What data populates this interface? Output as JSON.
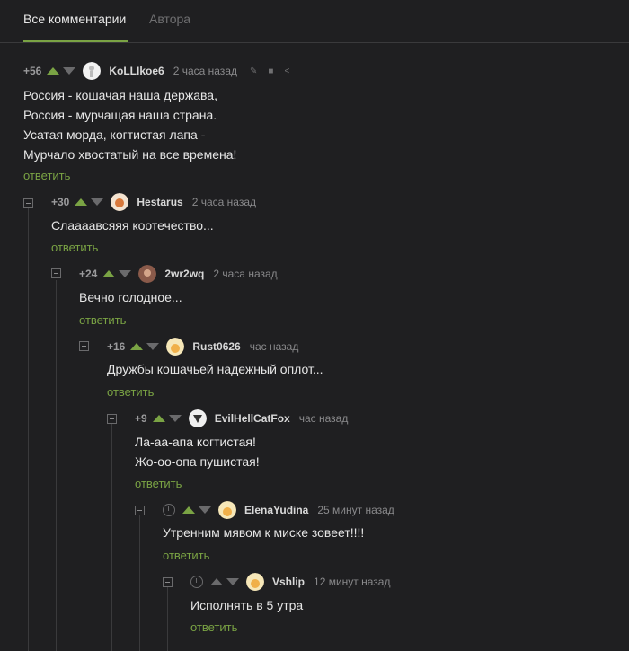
{
  "tabs": {
    "all_comments": "Все комментарии",
    "author": "Автора"
  },
  "colors": {
    "accent": "#7aa344",
    "background": "#1f1f21"
  },
  "comments": [
    {
      "score": "+56",
      "username": "KoLLIkoe6",
      "time": "2 часа назад",
      "lines": [
        "Россия - кошачая наша держава,",
        "Россия - мурчащая наша страна.",
        "Усатая морда, когтистая лапа -",
        "Мурчало хвостатый на все времена!"
      ],
      "reply": "ответить",
      "icons": [
        "pencil-icon",
        "save-icon",
        "share-icon"
      ]
    },
    {
      "score": "+30",
      "username": "Hestarus",
      "time": "2 часа назад",
      "lines": [
        "Слаааавсяяя коотечество..."
      ],
      "reply": "ответить"
    },
    {
      "score": "+24",
      "username": "2wr2wq",
      "time": "2 часа назад",
      "lines": [
        "Вечно голодное..."
      ],
      "reply": "ответить"
    },
    {
      "score": "+16",
      "username": "Rust0626",
      "time": "час назад",
      "lines": [
        "Дружбы кошачьей надежный оплот..."
      ],
      "reply": "ответить"
    },
    {
      "score": "+9",
      "username": "EvilHellCatFox",
      "time": "час назад",
      "lines": [
        "Ла-аа-апа когтистая!",
        "Жо-оо-опа пушистая!"
      ],
      "reply": "ответить"
    },
    {
      "score": "",
      "username": "ElenaYudina",
      "time": "25 минут назад",
      "lines": [
        "Утренним мявом к миске зовеет!!!!"
      ],
      "reply": "ответить"
    },
    {
      "score": "",
      "username": "Vshlip",
      "time": "12 минут назад",
      "lines": [
        "Исполнять в 5 утра"
      ],
      "reply": "ответить"
    }
  ]
}
